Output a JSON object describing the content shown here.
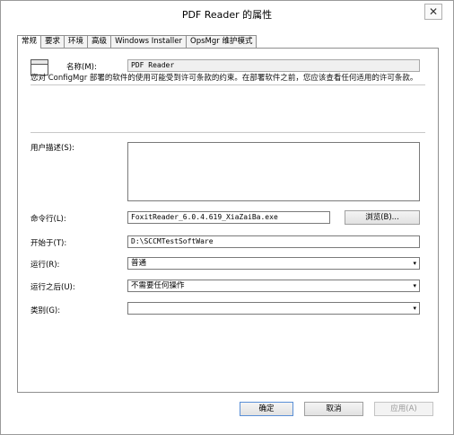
{
  "window": {
    "title": "PDF Reader 的属性",
    "close_glyph": "✕"
  },
  "tabs": [
    {
      "label": "常规",
      "active": true
    },
    {
      "label": "要求",
      "active": false
    },
    {
      "label": "环境",
      "active": false
    },
    {
      "label": "高级",
      "active": false
    },
    {
      "label": "Windows Installer",
      "active": false
    },
    {
      "label": "OpsMgr 维护模式",
      "active": false
    }
  ],
  "general": {
    "name_label": "名称(M):",
    "name_value": "PDF Reader",
    "notice": "您对 ConfigMgr 部署的软件的使用可能受到许可条款的约束。在部署软件之前，您应该查看任何适用的许可条款。",
    "user_desc_label": "用户描述(S):",
    "user_desc_value": "",
    "command_label": "命令行(L):",
    "command_value": "FoxitReader_6.0.4.619_XiaZaiBa.exe",
    "browse_label": "浏览(B)...",
    "start_in_label": "开始于(T):",
    "start_in_value": "D:\\SCCMTestSoftWare",
    "run_label": "运行(R):",
    "run_value": "普通",
    "after_run_label": "运行之后(U):",
    "after_run_value": "不需要任何操作",
    "category_label": "类别(G):",
    "category_value": ""
  },
  "footer": {
    "ok_label": "确定",
    "cancel_label": "取消",
    "apply_label": "应用(A)"
  },
  "icons": {
    "app": "program-window-icon",
    "scroll_up": "▲",
    "scroll_down": "▼",
    "dropdown": "▾"
  }
}
